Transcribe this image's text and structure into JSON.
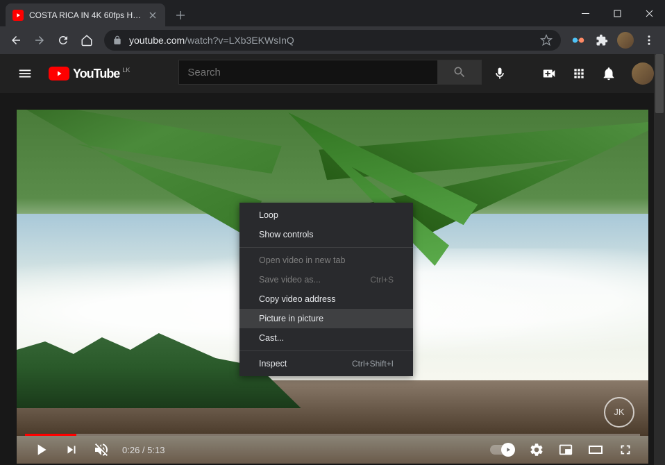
{
  "browser": {
    "tab_title": "COSTA RICA IN 4K 60fps HDR (U...",
    "url_domain": "youtube.com",
    "url_path": "/watch?v=LXb3EKWsInQ"
  },
  "yt": {
    "logo_text": "YouTube",
    "region": "LK",
    "search_placeholder": "Search"
  },
  "player": {
    "current_time": "0:26",
    "duration": "5:13",
    "watermark": "JK"
  },
  "ctx": {
    "loop": "Loop",
    "show_controls": "Show controls",
    "open_new_tab": "Open video in new tab",
    "save_as": "Save video as...",
    "save_as_shortcut": "Ctrl+S",
    "copy_address": "Copy video address",
    "pip": "Picture in picture",
    "cast": "Cast...",
    "inspect": "Inspect",
    "inspect_shortcut": "Ctrl+Shift+I"
  }
}
